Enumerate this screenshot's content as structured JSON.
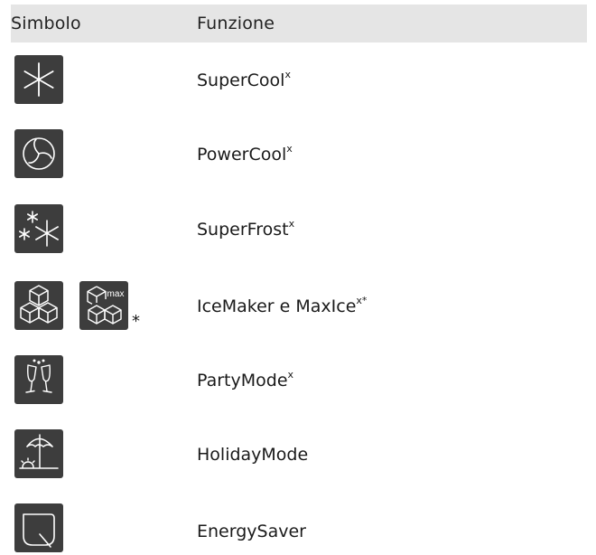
{
  "header": {
    "symbol": "Simbolo",
    "function": "Funzione"
  },
  "rows": [
    {
      "icon": "snowflake-icon",
      "label": "SuperCool",
      "sup": "x"
    },
    {
      "icon": "fan-icon",
      "label": "PowerCool",
      "sup": "x"
    },
    {
      "icon": "snowflakes-icon",
      "label": "SuperFrost",
      "sup": "x"
    },
    {
      "icon": "ice-cubes-icon",
      "icon2": "ice-cubes-max-icon",
      "icon2_text": "max",
      "icon_note": "*",
      "label": "IceMaker e MaxIce",
      "sup": "x*"
    },
    {
      "icon": "champagne-glasses-icon",
      "label": "PartyMode",
      "sup": "x"
    },
    {
      "icon": "beach-umbrella-icon",
      "label": "HolidayMode",
      "sup": ""
    },
    {
      "icon": "leaf-icon",
      "label": "EnergySaver",
      "sup": ""
    }
  ],
  "colors": {
    "header_bg": "#e5e5e5",
    "icon_bg": "#3d3d3d",
    "icon_fg": "#ffffff"
  }
}
